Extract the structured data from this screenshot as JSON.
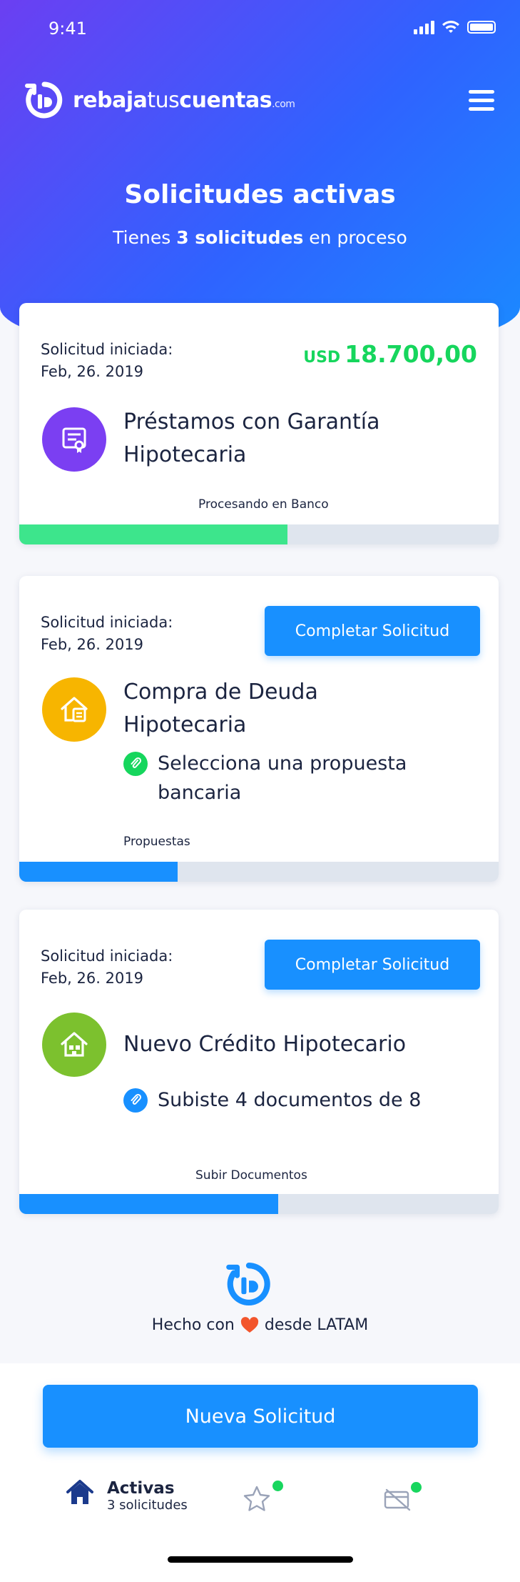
{
  "status_bar": {
    "time": "9:41"
  },
  "brand": {
    "name_bold": "rebaja",
    "name_light": "tus",
    "name_bold2": "cuentas",
    "suffix": ".com"
  },
  "header": {
    "title": "Solicitudes activas",
    "subtitle_pre": "Tienes ",
    "subtitle_bold": "3 solicitudes",
    "subtitle_post": " en proceso"
  },
  "cards": [
    {
      "date_label": "Solicitud iniciada:",
      "date": "Feb, 26. 2019",
      "currency": "USD",
      "amount": "18.700,00",
      "title_line1": "Préstamos con Garantía",
      "title_line2": "Hipotecaria",
      "icon": "certificate-icon",
      "icon_color": "#7b3ff2",
      "stage": "Procesando en Banco",
      "progress": 0.56,
      "progress_color": "#3de58c"
    },
    {
      "date_label": "Solicitud iniciada:",
      "date": "Feb, 26. 2019",
      "cta": "Completar Solicitud",
      "title_line1": "Compra de Deuda",
      "title_line2": "Hipotecaria",
      "hint_line1": "Selecciona una propuesta",
      "hint_line2": "bancaria",
      "icon": "house-money-icon",
      "icon_color": "#f7b500",
      "hint_icon_color": "#16d65d",
      "stage": "Propuestas",
      "progress": 0.33,
      "progress_color": "#1890ff"
    },
    {
      "date_label": "Solicitud iniciada:",
      "date": "Feb, 26. 2019",
      "cta": "Completar Solicitud",
      "title_line1": "Nuevo Crédito Hipotecario",
      "hint_line1": "Subiste 4 documentos de 8",
      "icon": "house-building-icon",
      "icon_color": "#7cc12e",
      "hint_icon_color": "#1890ff",
      "stage": "Subir Documentos",
      "progress": 0.54,
      "progress_color": "#1890ff"
    }
  ],
  "footer": {
    "made_pre": "Hecho con",
    "made_post": "desde LATAM"
  },
  "bottom": {
    "new_button": "Nueva Solicitud",
    "tab_active_label": "Activas",
    "tab_active_sub": "3 solicitudes",
    "dot_color": "#18d65e"
  },
  "colors": {
    "primary": "#1890ff",
    "success": "#16d65d",
    "text": "#1b2440"
  }
}
